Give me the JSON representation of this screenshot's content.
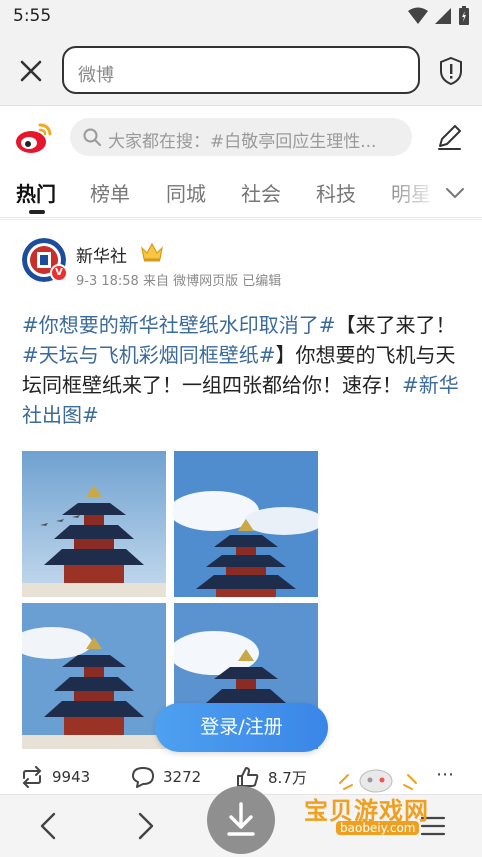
{
  "status_bar": {
    "time": "5:55"
  },
  "browser": {
    "url_text": "微博"
  },
  "weibo_header": {
    "search_placeholder": "大家都在搜：#白敬亭回应生理性..."
  },
  "tabs": [
    {
      "label": "热门",
      "active": true
    },
    {
      "label": "榜单",
      "active": false
    },
    {
      "label": "同城",
      "active": false
    },
    {
      "label": "社会",
      "active": false
    },
    {
      "label": "科技",
      "active": false
    },
    {
      "label": "明星",
      "active": false
    }
  ],
  "post": {
    "author": "新华社",
    "avatar_badge": "V",
    "meta": "9-3 18:58 来自 微博网页版 已编辑",
    "text_parts": [
      {
        "text": "#你想要的新华社壁纸水印取消了#",
        "tag": true
      },
      {
        "text": "【来了来了！",
        "tag": false
      },
      {
        "text": "#天坛与飞机彩烟同框壁纸#",
        "tag": true
      },
      {
        "text": "】你想要的飞机与天坛同框壁纸来了！一组四张都给你！速存！",
        "tag": false
      },
      {
        "text": "#新华社出图#",
        "tag": true
      }
    ],
    "images": [
      {
        "name": "temple-of-heaven-photo-1"
      },
      {
        "name": "temple-of-heaven-photo-2"
      },
      {
        "name": "temple-of-heaven-photo-3"
      },
      {
        "name": "temple-of-heaven-photo-4"
      }
    ],
    "reposts": "9943",
    "comments": "3272",
    "likes": "8.7万"
  },
  "login_button": "登录/注册",
  "watermark": {
    "brand": "宝贝游戏网",
    "url": "baobeiy.com"
  },
  "colors": {
    "accent": "#3a86e8",
    "tag": "#3b6a9c",
    "watermark": "#f0a020"
  }
}
